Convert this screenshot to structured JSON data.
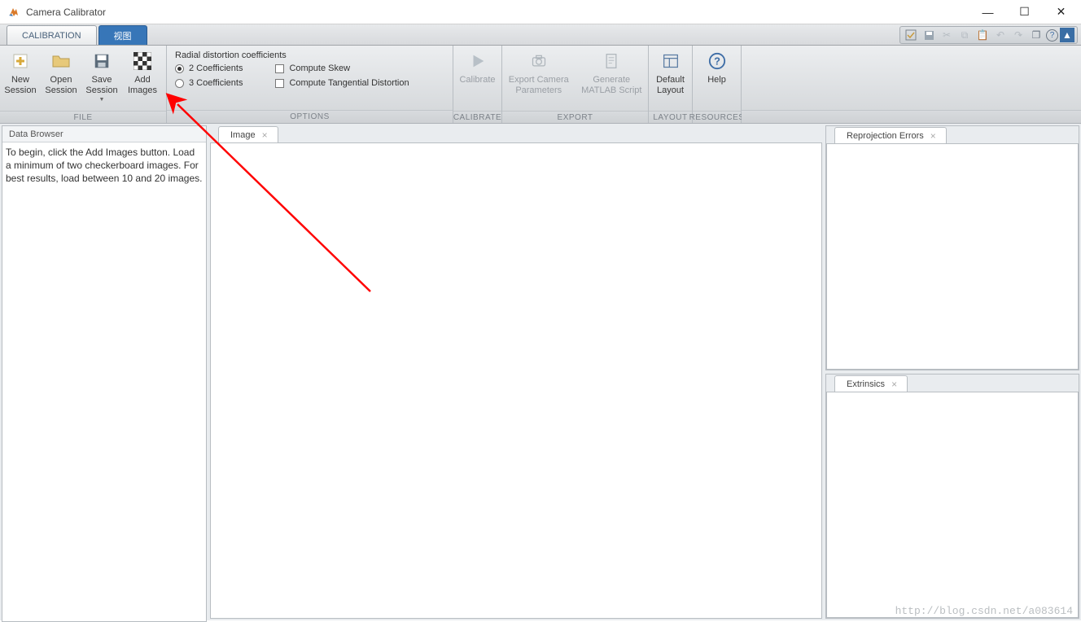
{
  "window": {
    "title": "Camera Calibrator"
  },
  "tabs": {
    "active": "CALIBRATION",
    "inactive": "视图"
  },
  "ribbon": {
    "groups": {
      "file": {
        "label": "FILE",
        "buttons": {
          "new": "New\nSession",
          "open": "Open\nSession",
          "save": "Save\nSession",
          "add": "Add\nImages"
        }
      },
      "options": {
        "label": "OPTIONS",
        "title": "Radial distortion coefficients",
        "radio1": "2 Coefficients",
        "radio2": "3 Coefficients",
        "check1": "Compute Skew",
        "check2": "Compute Tangential Distortion"
      },
      "calibrate": {
        "label": "CALIBRATE",
        "btn": "Calibrate"
      },
      "export": {
        "label": "EXPORT",
        "btn1": "Export Camera\nParameters",
        "btn2": "Generate\nMATLAB Script"
      },
      "layout": {
        "label": "LAYOUT",
        "btn": "Default\nLayout"
      },
      "resources": {
        "label": "RESOURCES",
        "btn": "Help"
      }
    }
  },
  "panels": {
    "data_browser": {
      "title": "Data Browser",
      "body": "To begin, click the Add Images button. Load a minimum of two checkerboard images. For best results, load between 10 and 20 images."
    },
    "image_tab": "Image",
    "reproj_tab": "Reprojection Errors",
    "extrinsics_tab": "Extrinsics"
  },
  "watermark": "http://blog.csdn.net/a083614"
}
